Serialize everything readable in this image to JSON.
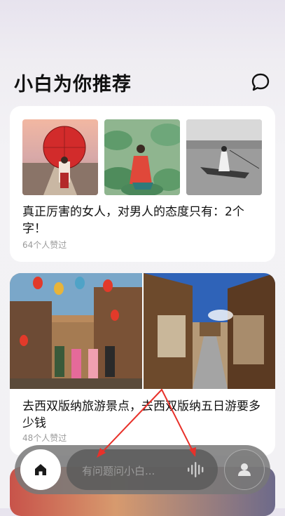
{
  "header": {
    "title": "小白为你推荐"
  },
  "feed": [
    {
      "title": "真正厉害的女人，对男人的态度只有：2个字！",
      "likes": "64个人赞过"
    },
    {
      "title": "去西双版纳旅游景点，去西双版纳五日游要多少钱",
      "likes": "48个人赞过"
    }
  ],
  "bottom_bar": {
    "ask_placeholder": "有问题问小白..."
  },
  "colors": {
    "annotation_arrow": "#e8312a",
    "bar": "#787878",
    "home_button": "#ffffff"
  }
}
